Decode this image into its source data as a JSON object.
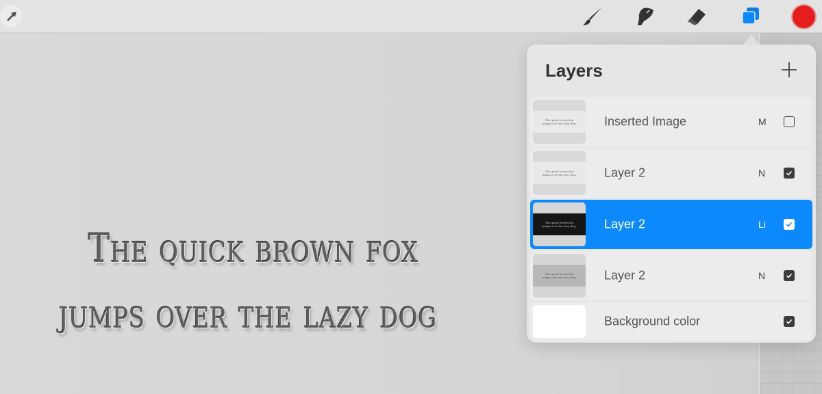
{
  "canvas": {
    "line1": "The quick brown fox",
    "line2": "jumps over the lazy dog"
  },
  "topbar": {
    "modify_icon": "arrow-cursor-icon",
    "tools": [
      {
        "name": "brush",
        "icon": "paintbrush-icon"
      },
      {
        "name": "smudge",
        "icon": "smudge-finger-icon"
      },
      {
        "name": "eraser",
        "icon": "eraser-icon"
      },
      {
        "name": "layers",
        "icon": "layers-icon",
        "active": true
      }
    ],
    "active_color": "#e51d1d",
    "accent": "#0c8afb"
  },
  "layers_panel": {
    "title": "Layers",
    "add_label": "+",
    "thumb_text": [
      "The quick brown fox",
      "jumps over the lazy dog."
    ],
    "layers": [
      {
        "name": "Inserted Image",
        "blend": "M",
        "visible": false,
        "selected": false,
        "thumb": "light"
      },
      {
        "name": "Layer 2",
        "blend": "N",
        "visible": true,
        "selected": false,
        "thumb": "light"
      },
      {
        "name": "Layer 2",
        "blend": "Li",
        "visible": true,
        "selected": true,
        "thumb": "dark"
      },
      {
        "name": "Layer 2",
        "blend": "N",
        "visible": true,
        "selected": false,
        "thumb": "grey"
      },
      {
        "name": "Background color",
        "blend": "",
        "visible": true,
        "selected": false,
        "thumb": "white"
      }
    ]
  }
}
